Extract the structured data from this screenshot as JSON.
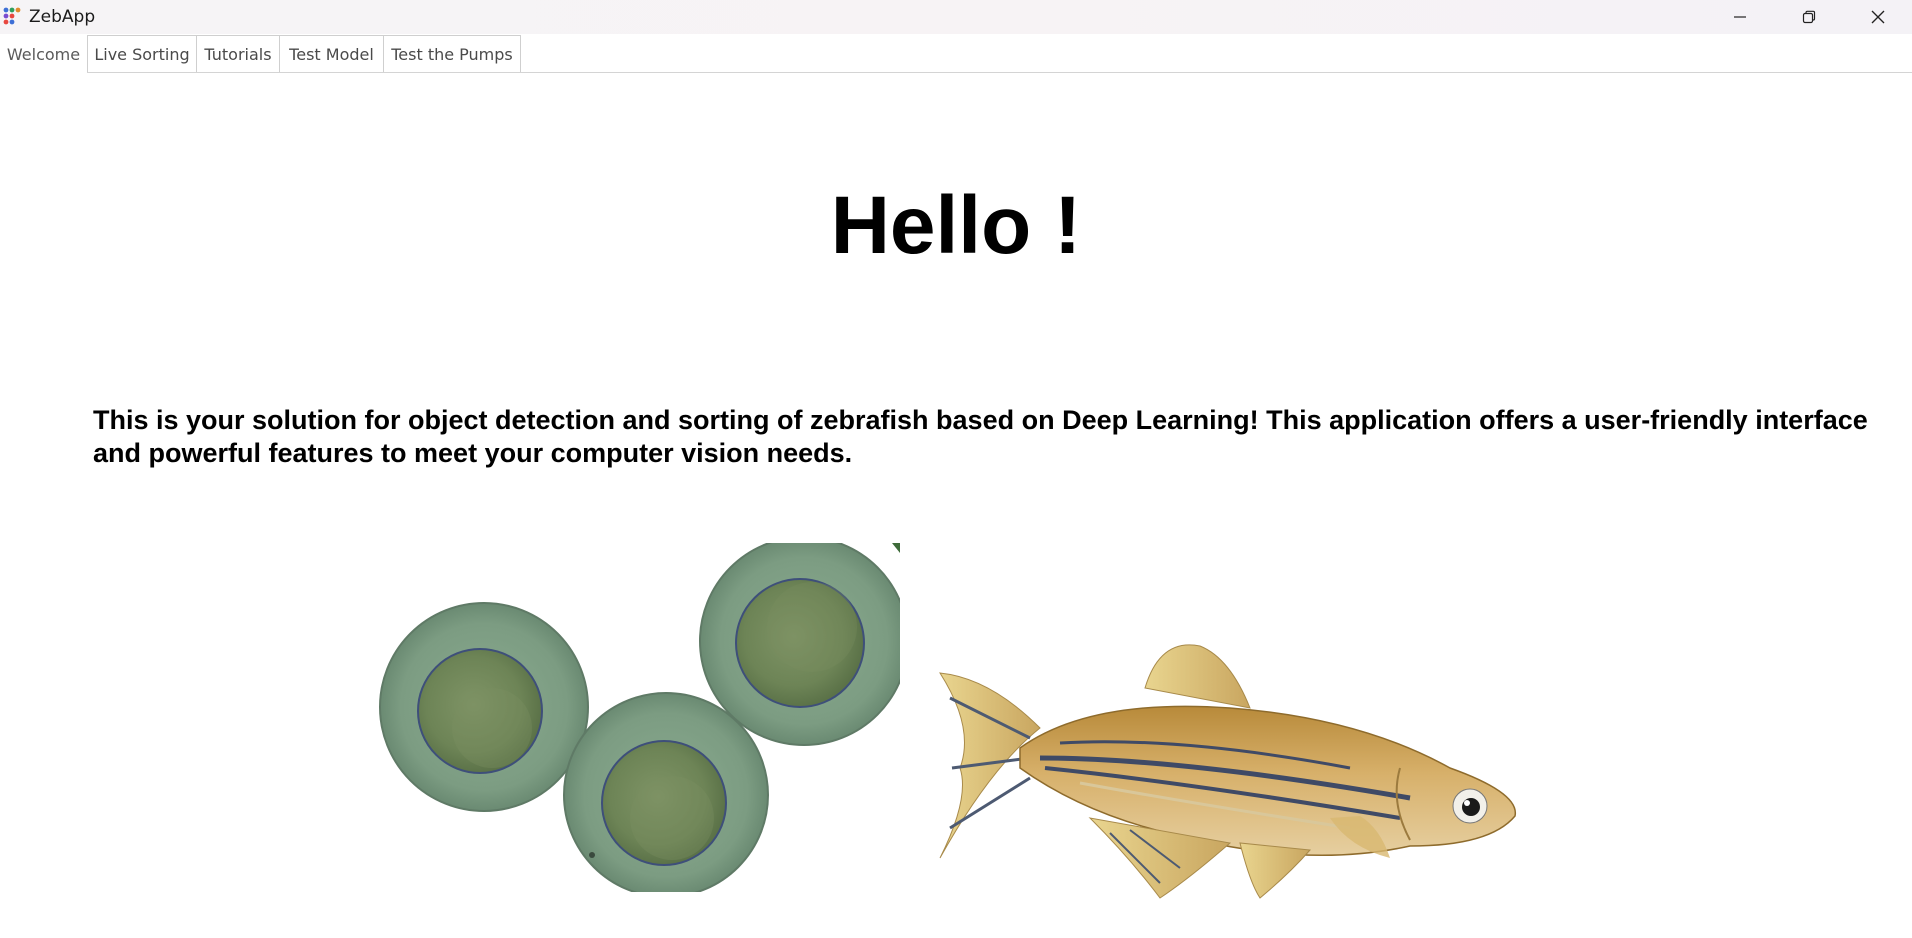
{
  "window": {
    "title": "ZebApp",
    "controls": {
      "minimize": "minimize-icon",
      "restore": "restore-icon",
      "close": "close-icon"
    }
  },
  "tabs": [
    {
      "label": "Welcome",
      "active": true
    },
    {
      "label": "Live Sorting",
      "active": false
    },
    {
      "label": "Tutorials",
      "active": false
    },
    {
      "label": "Test Model",
      "active": false
    },
    {
      "label": "Test the Pumps",
      "active": false
    }
  ],
  "welcome": {
    "heading": "Hello !",
    "intro": "This is your solution for object detection and sorting of zebrafish based on Deep Learning! This application offers a user-friendly interface and powerful features to meet your computer vision needs."
  },
  "colors": {
    "text": "#000000",
    "tab_border": "#cfcfcf",
    "egg_outer": "#7f9f86",
    "egg_inner": "#6e8a5e",
    "fish_body": "#c9a25a"
  }
}
